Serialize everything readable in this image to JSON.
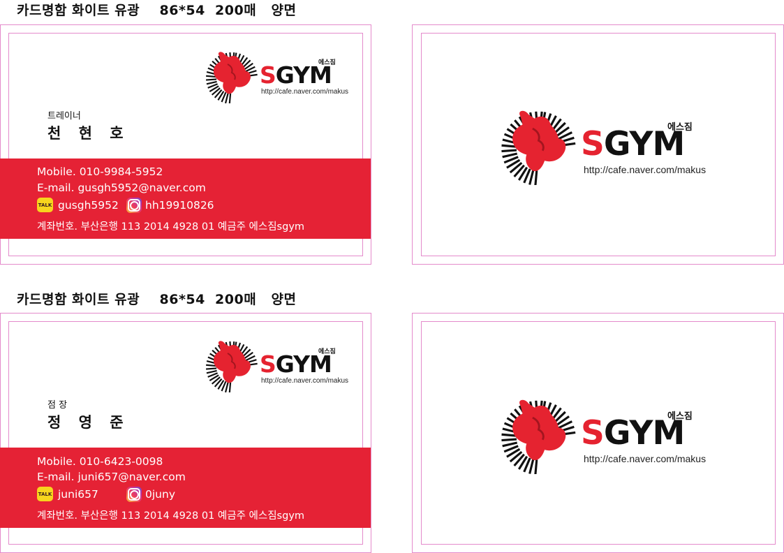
{
  "sheets": [
    {
      "title": "카드명함 화이트 유광    86*54  200매   양면",
      "front": {
        "role": "트레이너",
        "name": "천 현 호",
        "mobile": "Mobile. 010-9984-5952",
        "email": "E-mail. gusgh5952@naver.com",
        "kakao_id": "gusgh5952",
        "instagram_id": "hh19910826",
        "bank": "계좌번호. 부산은행 113 2014 4928 01 예금주 에스짐sgym"
      }
    },
    {
      "title": "카드명함 화이트 유광    86*54  200매   양면",
      "front": {
        "role": "점 장",
        "name": "정 영 준",
        "mobile": "Mobile. 010-6423-0098",
        "email": "E-mail. juni657@naver.com",
        "kakao_id": "juni657",
        "instagram_id": "0juny",
        "bank": "계좌번호. 부산은행 113 2014 4928 01 예금주 에스짐sgym"
      }
    }
  ],
  "logo": {
    "korean": "에스짐",
    "brand_s": "S",
    "brand_rest": "GYM",
    "url": "http://cafe.naver.com/makus"
  },
  "icons": {
    "kakao": "kakao-talk-icon",
    "kakao_label": "TALK",
    "instagram": "instagram-icon"
  },
  "colors": {
    "brand_red": "#e52235",
    "trim_line": "#e48acb",
    "text": "#111111"
  }
}
